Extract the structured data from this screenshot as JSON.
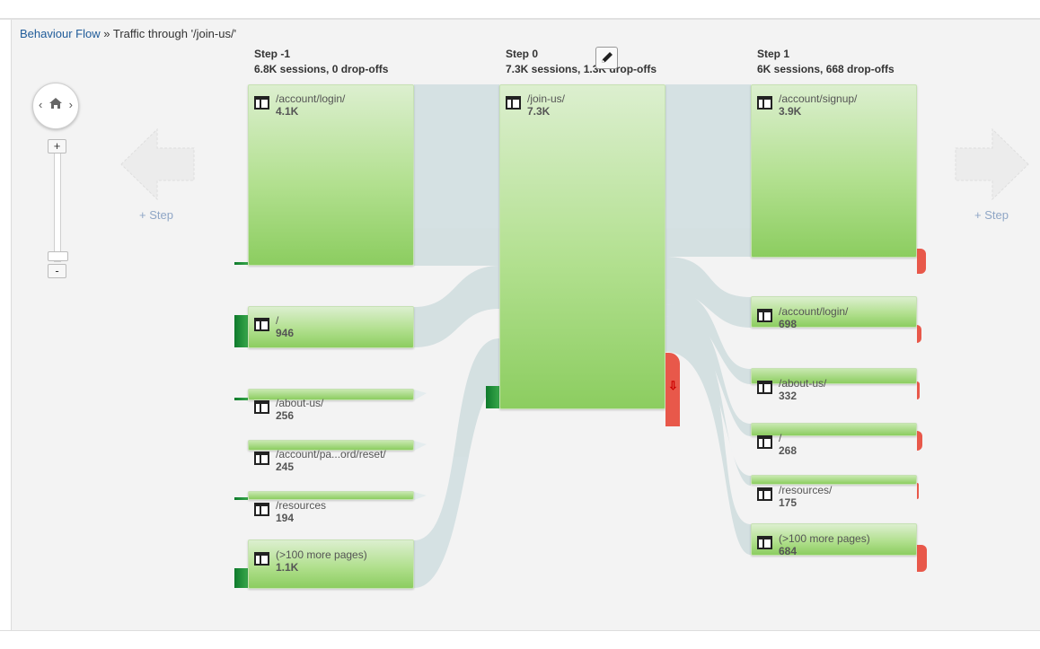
{
  "breadcrumb": {
    "root": "Behaviour Flow",
    "separator": "»",
    "current": "Traffic through '/join-us/'"
  },
  "steps": [
    {
      "title": "Step -1",
      "subtitle": "6.8K sessions, 0 drop-offs",
      "nodes": [
        {
          "label": "/account/login/",
          "count": "4.1K"
        },
        {
          "label": "/",
          "count": "946"
        },
        {
          "label": "/about-us/",
          "count": "256"
        },
        {
          "label": "/account/pa...ord/reset/",
          "count": "245"
        },
        {
          "label": "/resources",
          "count": "194"
        },
        {
          "label": "(>100 more pages)",
          "count": "1.1K"
        }
      ]
    },
    {
      "title": "Step 0",
      "subtitle": "7.3K sessions, 1.3K drop-offs",
      "nodes": [
        {
          "label": "/join-us/",
          "count": "7.3K"
        }
      ]
    },
    {
      "title": "Step 1",
      "subtitle": "6K sessions, 668 drop-offs",
      "nodes": [
        {
          "label": "/account/signup/",
          "count": "3.9K"
        },
        {
          "label": "/account/login/",
          "count": "698"
        },
        {
          "label": "/about-us/",
          "count": "332"
        },
        {
          "label": "/",
          "count": "268"
        },
        {
          "label": "/resources/",
          "count": "175"
        },
        {
          "label": "(>100 more pages)",
          "count": "684"
        }
      ]
    }
  ],
  "controls": {
    "add_step_left": "+ Step",
    "add_step_right": "+ Step",
    "zoom_in": "+",
    "zoom_out": "-",
    "pan_left": "‹",
    "pan_right": "›"
  },
  "colors": {
    "node_green": "#8ccd60",
    "node_light": "#dcefcf",
    "flow": "#d3dfe1",
    "dropoff": "#e8584a",
    "entry": "#1a8a35",
    "link": "#1f5b99"
  },
  "icons": [
    "page-icon",
    "home-icon",
    "pencil-icon",
    "drop-arrow-icon",
    "ghost-arrow-icon"
  ]
}
